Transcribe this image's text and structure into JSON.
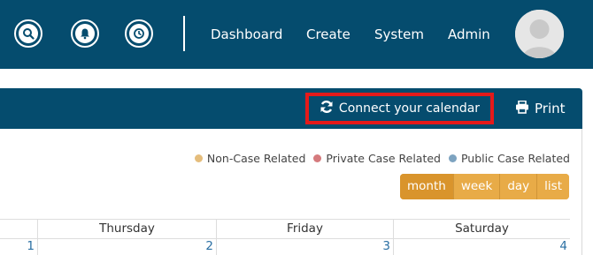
{
  "nav": {
    "icons": [
      "search-icon",
      "bell-icon",
      "clock-icon"
    ],
    "links": [
      "Dashboard",
      "Create",
      "System",
      "Admin"
    ]
  },
  "toolbar": {
    "connect_label": "Connect your calendar",
    "connect_icon": "sync-icon",
    "print_label": "Print",
    "print_icon": "printer-icon"
  },
  "legend": [
    {
      "label": "Non-Case Related",
      "color": "#e5bd7c"
    },
    {
      "label": "Private Case Related",
      "color": "#d57a7d"
    },
    {
      "label": "Public Case Related",
      "color": "#7da3c0"
    }
  ],
  "views": [
    "month",
    "week",
    "day",
    "list"
  ],
  "active_view": "month",
  "calendar": {
    "days": [
      "Thursday",
      "Friday",
      "Saturday"
    ],
    "dates": [
      "1",
      "2",
      "3",
      "4"
    ]
  },
  "colors": {
    "header_bg": "#054c6e",
    "highlight_border": "#e51a1a",
    "view_button": "#e8ab47",
    "date_link": "#2a6fa3"
  }
}
